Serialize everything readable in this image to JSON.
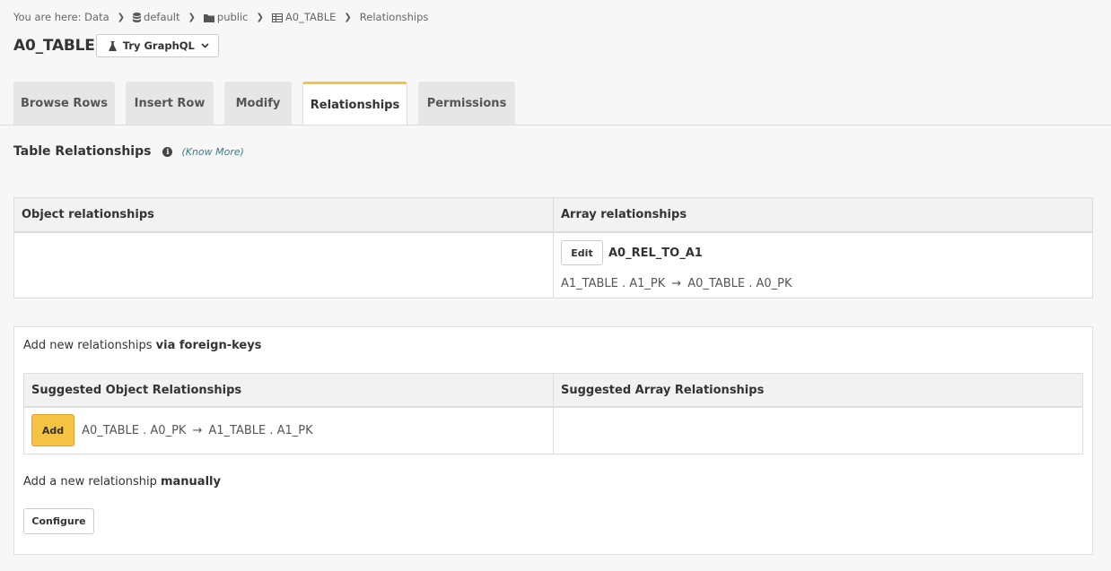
{
  "breadcrumb": {
    "prefix": "You are here: Data",
    "items": [
      "default",
      "public",
      "A0_TABLE",
      "Relationships"
    ]
  },
  "header": {
    "title": "A0_TABLE",
    "try_graphql": "Try GraphQL"
  },
  "tabs": [
    "Browse Rows",
    "Insert Row",
    "Modify",
    "Relationships",
    "Permissions"
  ],
  "active_tab": "Relationships",
  "section": {
    "title": "Table Relationships",
    "know_more": "(Know More)"
  },
  "relationships": {
    "object_header": "Object relationships",
    "array_header": "Array relationships",
    "array_items": [
      {
        "edit_label": "Edit",
        "name": "A0_REL_TO_A1",
        "from": "A1_TABLE . A1_PK",
        "arrow": "→",
        "to": "A0_TABLE . A0_PK"
      }
    ]
  },
  "foreign_keys": {
    "heading_prefix": "Add new relationships",
    "heading_bold": "via foreign-keys",
    "object_header": "Suggested Object Relationships",
    "array_header": "Suggested Array Relationships",
    "suggestions": [
      {
        "add_label": "Add",
        "from": "A0_TABLE . A0_PK",
        "arrow": "→",
        "to": "A1_TABLE . A1_PK"
      }
    ],
    "manual_prefix": "Add a new relationship",
    "manual_bold": "manually",
    "configure_label": "Configure"
  },
  "colors": {
    "accent": "#f5c242",
    "link": "#3a7c8c"
  }
}
